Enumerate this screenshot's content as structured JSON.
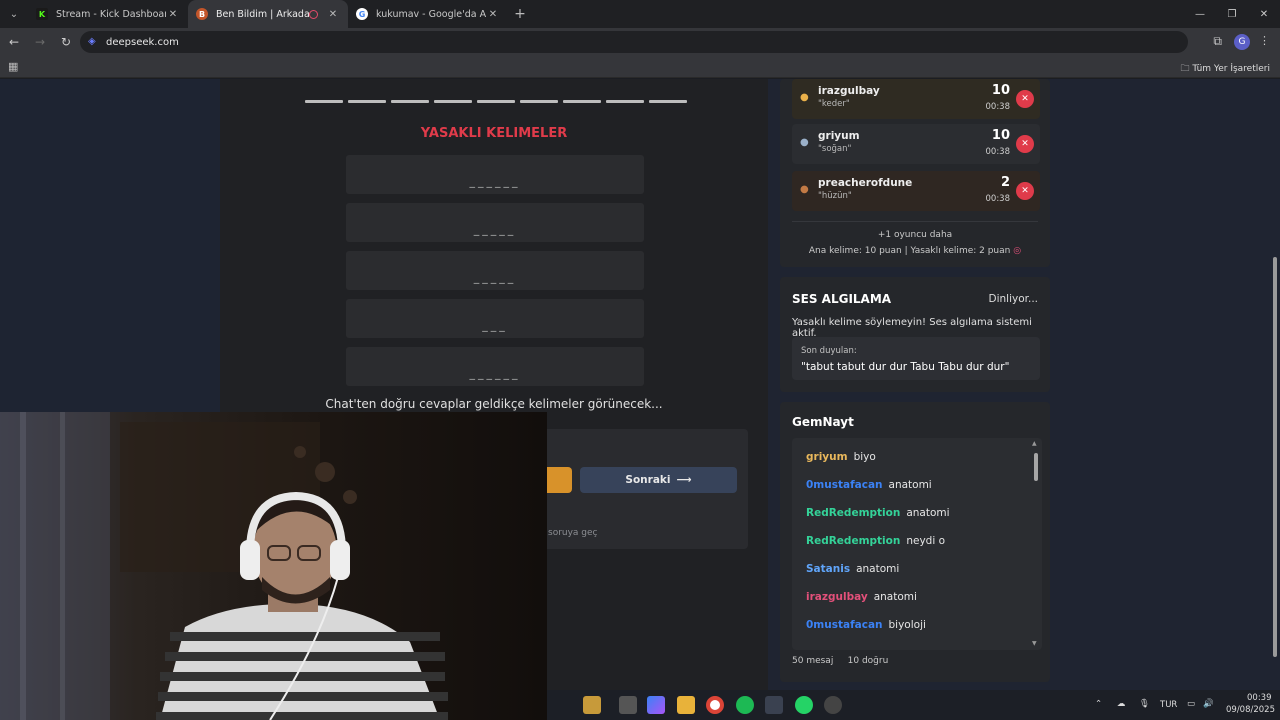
{
  "browser": {
    "tabs": [
      {
        "title": "Stream - Kick Dashboard",
        "active": false
      },
      {
        "title": "Ben Bildim | Arkadaşlarınla",
        "active": true
      },
      {
        "title": "kukumav - Google'da Ara",
        "active": false
      }
    ],
    "url": "deepseek.com",
    "bookmarks_label": "Tüm Yer İşaretleri"
  },
  "game": {
    "forbidden_title": "YASAKLI KELIMELER",
    "slots": [
      "______",
      "_____",
      "_____",
      "___",
      "______"
    ],
    "hint": "Chat'ten doğru cevaplar geldikçe kelimeler görünecek...",
    "next_label": "Sonraki",
    "skip_label": "soruya geç"
  },
  "leaderboard": {
    "players": [
      {
        "name": "irazgulbay",
        "word": "\"keder\"",
        "score": "10",
        "time": "00:38",
        "medal": "gold"
      },
      {
        "name": "griyum",
        "word": "\"soğan\"",
        "score": "10",
        "time": "00:38",
        "medal": "silver"
      },
      {
        "name": "preacherofdune",
        "word": "\"hüzün\"",
        "score": "2",
        "time": "00:38",
        "medal": "bronze"
      }
    ],
    "more_text": "+1 oyuncu daha",
    "rules_text": "Ana kelime: 10 puan | Yasaklı kelime: 2 puan"
  },
  "voice": {
    "title": "SES ALGILAMA",
    "status": "Dinliyor...",
    "description": "Yasaklı kelime söylemeyin! Ses algılama sistemi aktif.",
    "last_heard_label": "Son duyulan:",
    "last_heard_value": "\"tabut tabut dur dur Tabu Tabu dur dur\""
  },
  "chat": {
    "title": "GemNayt",
    "messages": [
      {
        "user": "griyum",
        "text": "biyo",
        "color": "#e9b85c"
      },
      {
        "user": "0mustafacan",
        "text": "anatomi",
        "color": "#3b82f6"
      },
      {
        "user": "RedRedemption",
        "text": "anatomi",
        "color": "#34d399"
      },
      {
        "user": "RedRedemption",
        "text": "neydi o",
        "color": "#34d399"
      },
      {
        "user": "Satanis",
        "text": "anatomi",
        "color": "#60a5fa"
      },
      {
        "user": "irazgulbay",
        "text": "anatomi",
        "color": "#e3507a"
      },
      {
        "user": "0mustafacan",
        "text": "biyoloji",
        "color": "#3b82f6"
      }
    ],
    "message_count": "50 mesaj",
    "correct_count": "10 doğru"
  },
  "taskbar": {
    "lang": "TUR",
    "time": "00:39",
    "date": "09/08/2025"
  },
  "colors": {
    "accent_red": "#e03b4a",
    "next_button": "#37435a",
    "yellow_button": "#d8922a"
  }
}
